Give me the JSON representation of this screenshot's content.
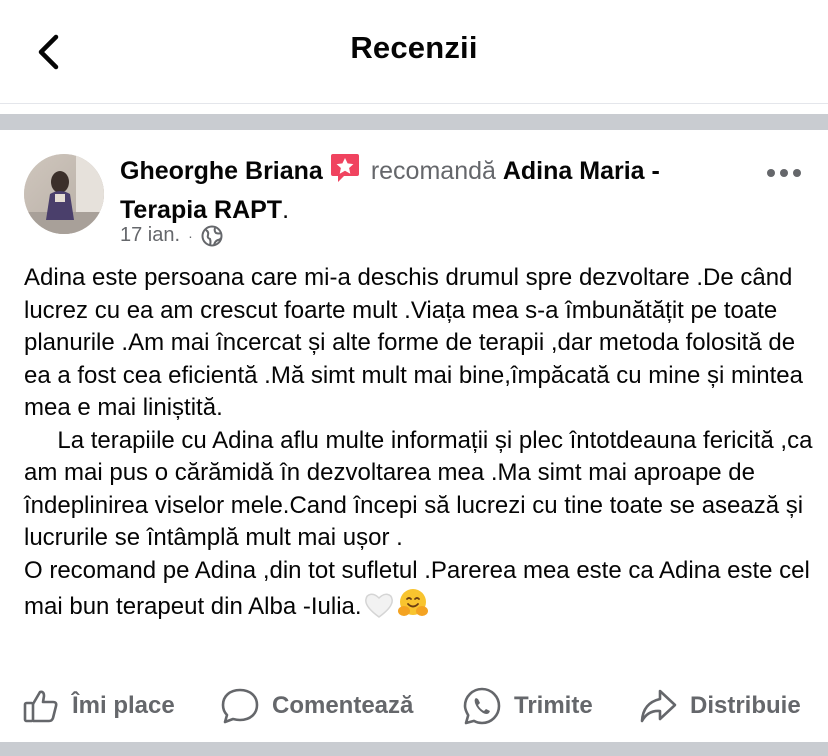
{
  "header": {
    "title": "Recenzii"
  },
  "post": {
    "author": "Gheorghe Briana",
    "recommends": "recomandă",
    "page_name": "Adina Maria - Terapia RAPT",
    "punct": ".",
    "date": "17 ian.",
    "meta_dot": "·",
    "paragraphs": [
      "Adina este persoana care mi-a deschis drumul spre dezvoltare .De când  lucrez cu ea am crescut foarte mult .Viața mea s-a îmbunătățit pe toate planurile .Am mai încercat și alte forme de terapii ,dar metoda folosită de ea a fost cea eficientă .Mă simt mult mai bine,împăcată cu mine și mintea mea e mai liniștită.",
      "     La terapiile cu Adina aflu multe informații și plec întotdeauna fericită ,ca am mai pus o cărămidă în dezvoltarea mea .Ma simt mai aproape de îndeplinirea viselor mele.Cand începi să lucrezi cu tine toate se asează și lucrurile se întâmplă mult mai ușor .",
      "O recomand pe Adina ,din tot sufletul .Parerea mea este ca Adina este cel mai bun terapeut din Alba -Iulia."
    ],
    "icons": {
      "badge": "star-badge-icon",
      "privacy": "globe-icon",
      "more": "more-options-icon",
      "heart": "white-heart-emoji",
      "hug": "hugging-face-emoji"
    }
  },
  "actions": {
    "like": "Îmi place",
    "comment": "Comentează",
    "send": "Trimite",
    "share": "Distribuie"
  },
  "colors": {
    "text": "#050505",
    "secondary": "#65676b",
    "separator": "#c9ccd1",
    "badge": "#f0435f"
  }
}
